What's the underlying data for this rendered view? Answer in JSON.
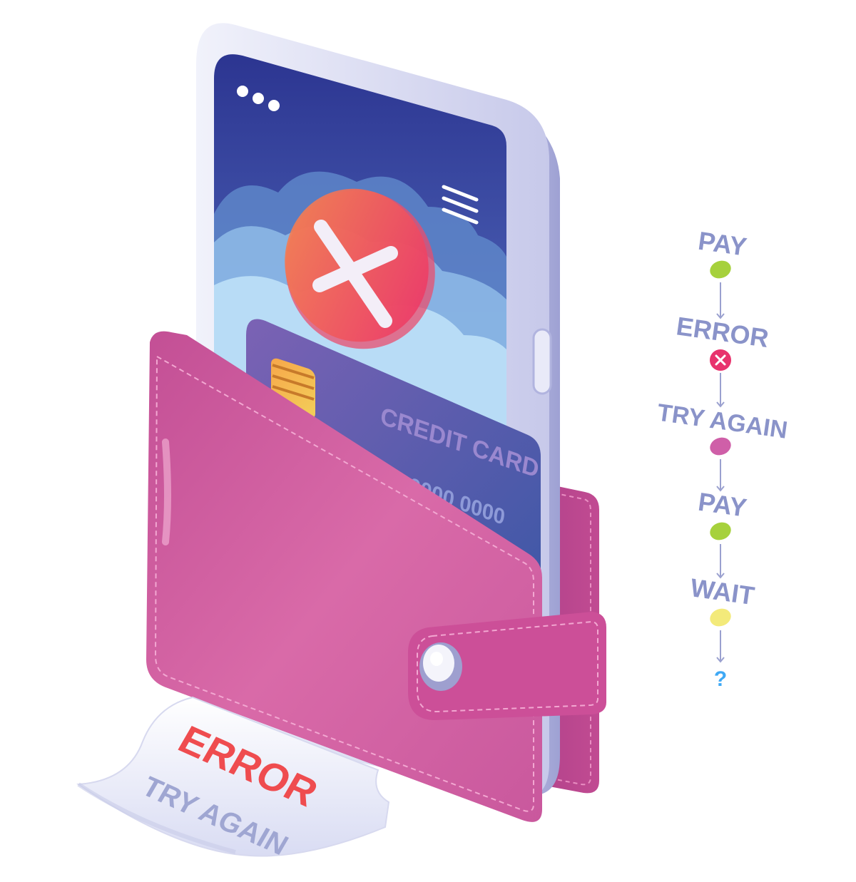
{
  "phone": {
    "menu_dots_icon": "more-dots-icon",
    "hamburger_icon": "menu-icon",
    "status_icon": "error-x-icon"
  },
  "card": {
    "label": "CREDIT CARD",
    "number_partial": "0000 0000"
  },
  "receipt": {
    "line1": "ERROR",
    "line2": "TRY AGAIN"
  },
  "flow": {
    "steps": [
      {
        "label": "PAY",
        "marker": "dot",
        "color": "#a6d13c"
      },
      {
        "label": "ERROR",
        "marker": "x",
        "color": "#e8336d"
      },
      {
        "label": "TRY AGAIN",
        "marker": "dot",
        "color": "#cf5fa8"
      },
      {
        "label": "PAY",
        "marker": "dot",
        "color": "#a6d13c"
      },
      {
        "label": "WAIT",
        "marker": "dot",
        "color": "#f3ea7a"
      }
    ],
    "end_label": "?"
  },
  "colors": {
    "wallet": "#d4609f",
    "screen_top": "#2e3a94",
    "card": "#5b55a8",
    "error_red": "#f0586a",
    "question": "#3fa9f5"
  }
}
